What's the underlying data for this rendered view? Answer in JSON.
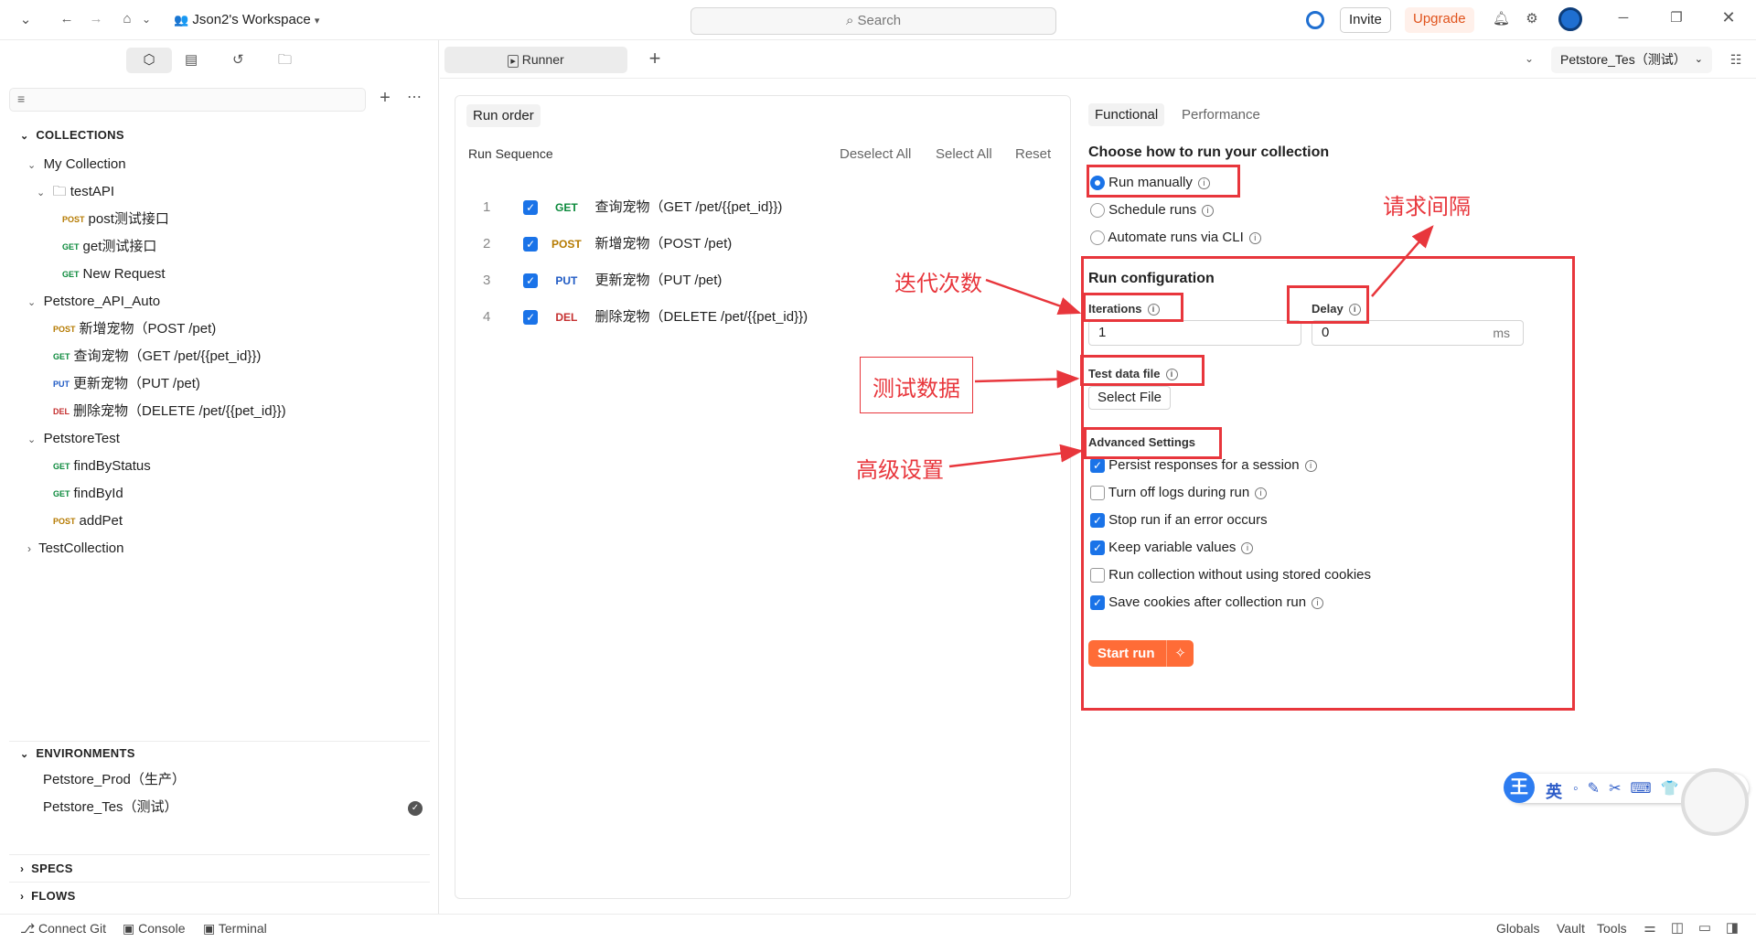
{
  "topbar": {
    "workspace": "Json2's Workspace",
    "search_placeholder": "Search",
    "invite": "Invite",
    "upgrade": "Upgrade"
  },
  "tabs": {
    "runner": "Runner",
    "environment_selector": "Petstore_Tes（测试）"
  },
  "sidebar": {
    "collections_header": "COLLECTIONS",
    "my_collection": "My Collection",
    "testapi": "testAPI",
    "testapi_items": [
      {
        "method": "POST",
        "label": "post测试接口"
      },
      {
        "method": "GET",
        "label": "get测试接口"
      },
      {
        "method": "GET",
        "label": "New Request"
      }
    ],
    "petstore_api_auto": "Petstore_API_Auto",
    "petstore_items": [
      {
        "method": "POST",
        "label": "新增宠物（POST /pet)"
      },
      {
        "method": "GET",
        "label": "查询宠物（GET /pet/{{pet_id}})"
      },
      {
        "method": "PUT",
        "label": "更新宠物（PUT /pet)"
      },
      {
        "method": "DEL",
        "label": "删除宠物（DELETE /pet/{{pet_id}})"
      }
    ],
    "petstoretest": "PetstoreTest",
    "petstoretest_items": [
      {
        "method": "GET",
        "label": "findByStatus"
      },
      {
        "method": "GET",
        "label": "findById"
      },
      {
        "method": "POST",
        "label": "addPet"
      }
    ],
    "testcollection": "TestCollection",
    "environments_header": "ENVIRONMENTS",
    "env_prod": "Petstore_Prod（生产）",
    "env_test": "Petstore_Tes（测试）",
    "specs_header": "SPECS",
    "flows_header": "FLOWS"
  },
  "run_order": {
    "title": "Run order",
    "sequence_label": "Run Sequence",
    "deselect_all": "Deselect All",
    "select_all": "Select All",
    "reset": "Reset",
    "items": [
      {
        "num": "1",
        "method": "GET",
        "label": "查询宠物（GET /pet/{{pet_id}})"
      },
      {
        "num": "2",
        "method": "POST",
        "label": "新增宠物（POST /pet)"
      },
      {
        "num": "3",
        "method": "PUT",
        "label": "更新宠物（PUT /pet)"
      },
      {
        "num": "4",
        "method": "DEL",
        "label": "删除宠物（DELETE /pet/{{pet_id}})"
      }
    ]
  },
  "config": {
    "tab_functional": "Functional",
    "tab_performance": "Performance",
    "choose_heading": "Choose how to run your collection",
    "run_manually": "Run manually",
    "schedule_runs": "Schedule runs",
    "automate_cli": "Automate runs via CLI",
    "run_config_heading": "Run configuration",
    "iterations_label": "Iterations",
    "iterations_value": "1",
    "delay_label": "Delay",
    "delay_value": "0",
    "delay_unit": "ms",
    "test_data_label": "Test data file",
    "select_file": "Select File",
    "advanced_label": "Advanced Settings",
    "options": [
      {
        "label": "Persist responses for a session",
        "checked": true,
        "info": true
      },
      {
        "label": "Turn off logs during run",
        "checked": false,
        "info": true
      },
      {
        "label": "Stop run if an error occurs",
        "checked": true,
        "info": false
      },
      {
        "label": "Keep variable values",
        "checked": true,
        "info": true
      },
      {
        "label": "Run collection without using stored cookies",
        "checked": false,
        "info": false
      },
      {
        "label": "Save cookies after collection run",
        "checked": true,
        "info": true
      }
    ],
    "start_run": "Start run"
  },
  "annotations": {
    "iterations": "迭代次数",
    "delay": "请求间隔",
    "test_data": "测试数据",
    "advanced": "高级设置"
  },
  "ime_toolbar": {
    "logo": "王",
    "lang": "英"
  },
  "statusbar": {
    "connect_git": "Connect Git",
    "console": "Console",
    "terminal": "Terminal",
    "globals": "Globals",
    "vault": "Vault",
    "tools": "Tools"
  },
  "colors": {
    "accent": "#ff6c37",
    "checkbox": "#1a73e8",
    "annotation": "#e8363c"
  }
}
